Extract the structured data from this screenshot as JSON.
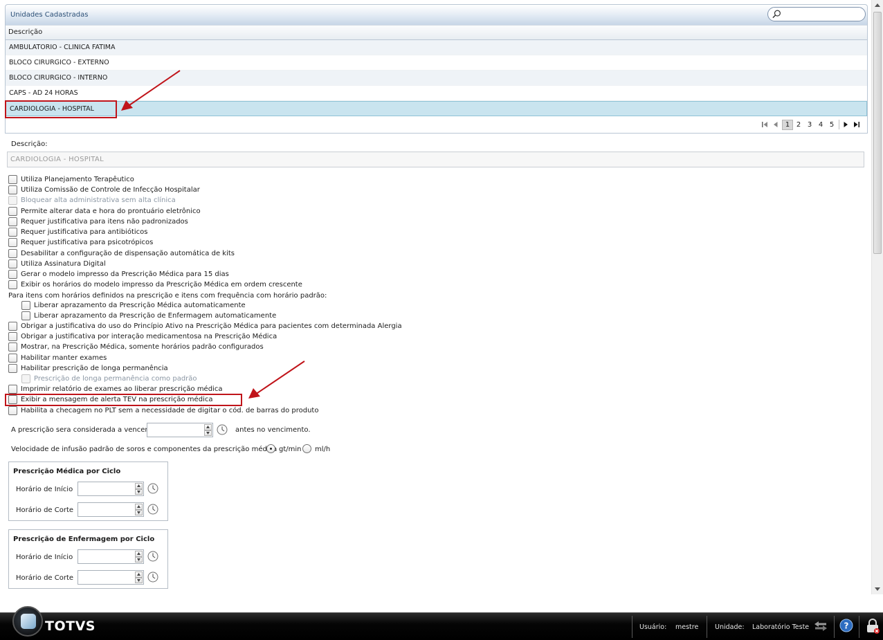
{
  "panel": {
    "title": "Unidades Cadastradas",
    "search_placeholder": ""
  },
  "grid": {
    "column_header": "Descrição",
    "rows": [
      "AMBULATORIO - CLINICA FATIMA",
      "BLOCO CIRURGICO - EXTERNO",
      "BLOCO CIRURGICO - INTERNO",
      "CAPS - AD 24 HORAS",
      "CARDIOLOGIA - HOSPITAL"
    ],
    "selected_row": "CARDIOLOGIA - HOSPITAL",
    "pages": [
      "1",
      "2",
      "3",
      "4",
      "5"
    ],
    "current_page": "1"
  },
  "form": {
    "description_label": "Descrição:",
    "description_value": "CARDIOLOGIA - HOSPITAL",
    "options": [
      "Utiliza Planejamento Terapêutico",
      "Utiliza Comissão de Controle de Infecção Hospitalar",
      "Bloquear alta administrativa sem alta clínica",
      "Permite alterar data e hora do prontuário eletrônico",
      "Requer justificativa para itens não padronizados",
      "Requer justificativa para antibióticos",
      "Requer justificativa para psicotrópicos",
      "Desabilitar a configuração de dispensação automática de kits",
      "Utiliza Assinatura Digital",
      "Gerar o modelo impresso da Prescrição Médica para 15 dias",
      "Exibir os horários do modelo impresso da Prescrição Médica em ordem crescente"
    ],
    "frequency_text": "Para itens com horários definidos na prescrição e itens com frequência com horário padrão:",
    "frequency_options": [
      "Liberar aprazamento da Prescrição Médica automaticamente",
      "Liberar aprazamento da Prescrição de Enfermagem automaticamente"
    ],
    "options2": [
      "Obrigar a justificativa do uso do Princípio Ativo na Prescrição Médica para pacientes com determinada Alergia",
      "Obrigar a justificativa por interação medicamentosa na Prescrição Médica",
      "Mostrar, na Prescrição Médica, somente horários padrão configurados",
      "Habilitar manter exames",
      "Habilitar prescrição de longa permanência"
    ],
    "long_term_sub": "Prescrição de longa permanência como padrão",
    "options3": [
      "Imprimir relatório de exames ao liberar prescrição médica",
      "Exibir a mensagem de alerta TEV na prescrição médica",
      "Habilita a checagem no PLT sem a necessidade de digitar o cód. de barras do produto"
    ],
    "expiry_label": "A prescrição sera considerada a vencer",
    "expiry_value": "",
    "expiry_suffix": "antes no vencimento.",
    "infusion_label": "Velocidade de infusão padrão de soros e componentes da prescrição médica",
    "infusion_options": [
      "gt/min",
      "ml/h"
    ],
    "infusion_selected": "gt/min",
    "medical_cycle": {
      "title": "Prescrição Médica por Ciclo",
      "start_label": "Horário de Início",
      "cut_label": "Horário de Corte",
      "start_value": "",
      "cut_value": ""
    },
    "nursing_cycle": {
      "title": "Prescrição de Enfermagem por Ciclo",
      "start_label": "Horário de Início",
      "cut_label": "Horário de Corte",
      "start_value": "",
      "cut_value": ""
    }
  },
  "status_bar": {
    "brand": "TOTVS",
    "user_label": "Usuário:",
    "user_value": "mestre",
    "unit_label": "Unidade:",
    "unit_value": "Laboratório Teste"
  },
  "colors": {
    "annotation_red": "#c0141a",
    "selected_row": "#c9e4ef",
    "header_blue": "#2b4f76"
  }
}
